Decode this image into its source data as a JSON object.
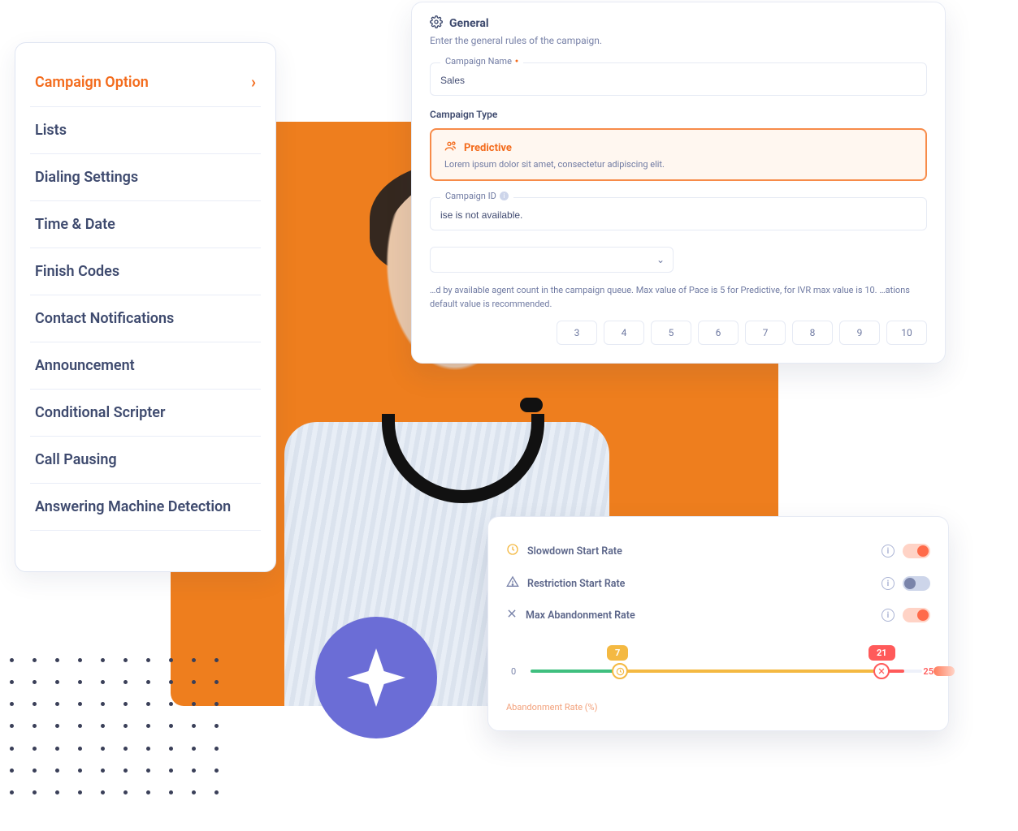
{
  "sidebar": {
    "items": [
      {
        "label": "Campaign Option",
        "active": true
      },
      {
        "label": "Lists"
      },
      {
        "label": "Dialing Settings"
      },
      {
        "label": "Time & Date"
      },
      {
        "label": "Finish Codes"
      },
      {
        "label": "Contact Notifications"
      },
      {
        "label": "Announcement"
      },
      {
        "label": "Conditional Scripter"
      },
      {
        "label": "Call Pausing"
      },
      {
        "label": "Answering Machine Detection"
      }
    ]
  },
  "general": {
    "title": "General",
    "subtitle": "Enter the general rules of the campaign.",
    "campaign_name": {
      "legend": "Campaign Name",
      "value": "Sales"
    },
    "campaign_type": {
      "label": "Campaign Type",
      "selected_name": "Predictive",
      "selected_desc": "Lorem ipsum dolor sit amet, consectetur adipiscing elit."
    },
    "campaign_id": {
      "legend": "Campaign ID",
      "hint": "ise is not available."
    },
    "pace": {
      "desc": "…d by available agent count in the campaign queue. Max value of Pace is 5 for Predictive, for IVR max value is 10. …ations default value is recommended.",
      "options": [
        "3",
        "4",
        "5",
        "6",
        "7",
        "8",
        "9",
        "10"
      ]
    }
  },
  "rates": {
    "rows": [
      {
        "icon": "clock",
        "label": "Slowdown Start Rate",
        "on": true
      },
      {
        "icon": "warn",
        "label": "Restriction Start Rate",
        "on": false
      },
      {
        "icon": "x",
        "label": "Max Abandonment Rate",
        "on": true
      }
    ],
    "slider": {
      "min_label": "0",
      "max_label": "25",
      "yellow_value": "7",
      "red_value": "21",
      "label": "Abandonment Rate (%)"
    }
  }
}
